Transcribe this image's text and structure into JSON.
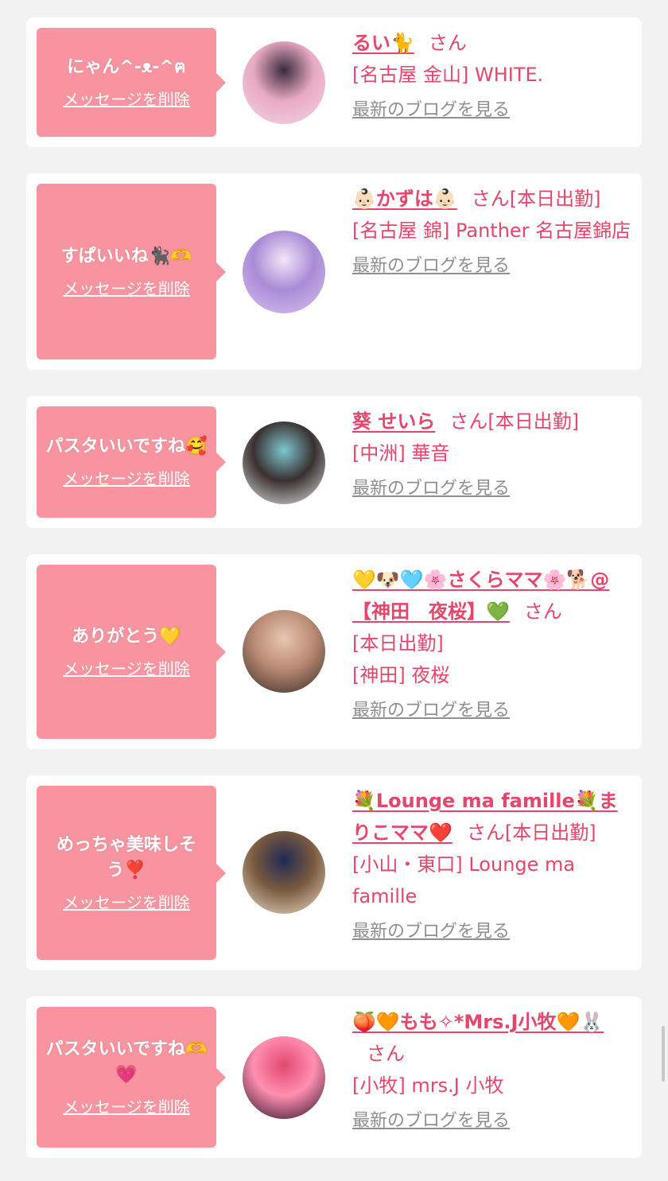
{
  "delete_label": "メッセージを削除",
  "blog_label": "最新のブログを見る",
  "san_label": "さん",
  "messages": [
    {
      "message": "にゃん^-ᴥ-^ฅ",
      "name": "るい🐈",
      "suffix": "",
      "shop_lines": [
        "[名古屋 金山] WHITE."
      ],
      "avatar_colors": [
        "#f3d6e6",
        "#3a2b3a",
        "#e8a9c4"
      ]
    },
    {
      "message": "すぱいいね🐈‍⬛🫶",
      "name": "👶🏻かずは👶🏻",
      "suffix": "[本日出勤]",
      "shop_lines": [
        "[名古屋 錦] Panther 名古屋錦店"
      ],
      "avatar_colors": [
        "#d9c2f0",
        "#f1e6f7",
        "#a98bd6"
      ]
    },
    {
      "message": "パスタいいですね🥰",
      "name": "葵 せいら",
      "suffix": "[本日出勤]",
      "shop_lines": [
        "[中洲] 華音"
      ],
      "avatar_colors": [
        "#e6e6e6",
        "#7cc7d1",
        "#3a3030"
      ]
    },
    {
      "message": "ありがとう💛",
      "name": "💛🐶🩵🌸さくらママ🌸🐕@【神田　夜桜】💚",
      "suffix": "",
      "extra_line": "[本日出勤]",
      "shop_lines": [
        "[神田] 夜桜"
      ],
      "avatar_colors": [
        "#3a2a24",
        "#e9c7b2",
        "#b88a74"
      ]
    },
    {
      "message": "めっちゃ美味しそう❣️",
      "name": "💐Lounge ma famille💐まりこママ❤️",
      "suffix": "[本日出勤]",
      "shop_lines": [
        "[小山・東口] Lounge ma famille"
      ],
      "avatar_colors": [
        "#e9ddc9",
        "#1f2a55",
        "#7a5a3e"
      ]
    },
    {
      "message": "パスタいいですね🫶💗",
      "name": "🍑🧡もも✧*Mrs.J小牧🧡🐰",
      "suffix": "",
      "shop_lines": [
        "[小牧] mrs.J 小牧"
      ],
      "avatar_colors": [
        "#2a0d2a",
        "#e3486f",
        "#ff8fb0"
      ]
    }
  ]
}
